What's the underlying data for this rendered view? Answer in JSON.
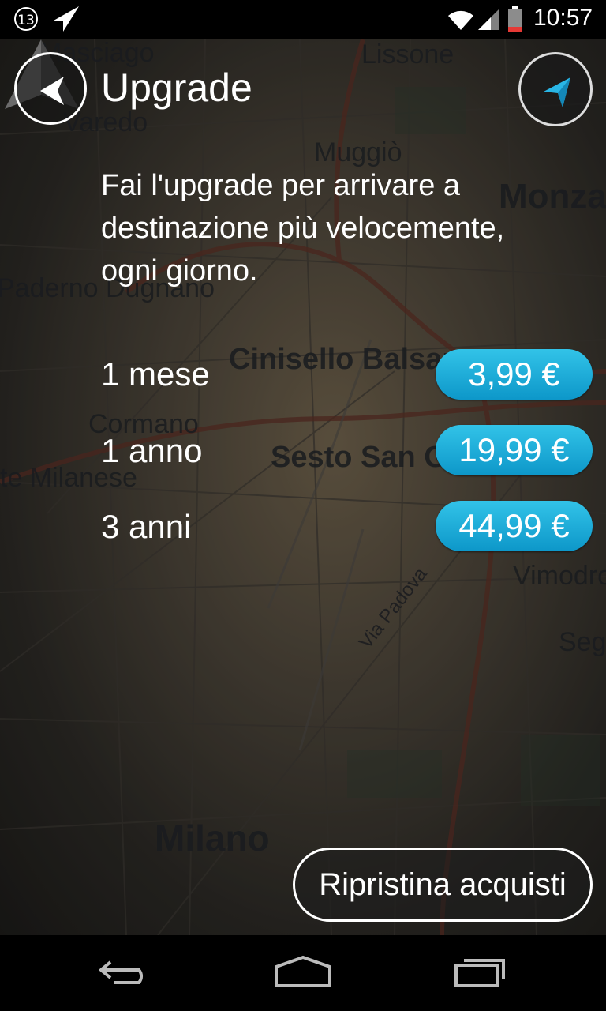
{
  "status_bar": {
    "notification_count": "13",
    "time": "10:57",
    "icons": [
      "notification-count-icon",
      "navigation-arrow-icon",
      "wifi-icon",
      "signal-icon",
      "battery-icon"
    ]
  },
  "map_labels": [
    "Masciago",
    "Lissone",
    "Varedo",
    "Muggiò",
    "Monza",
    "Paderno Dugnano",
    "Cinisello Balsamo",
    "Cormano",
    "Sesto San Giovanni",
    "te Milanese",
    "Vimodrone",
    "Via Padova",
    "Segrate",
    "Milano"
  ],
  "header": {
    "title": "Upgrade",
    "back_icon": "back-arrow-icon",
    "nav_icon": "current-location-arrow-icon"
  },
  "description": "Fai l'upgrade per arrivare a destinazione più velocemente, ogni giorno.",
  "plans": [
    {
      "label": "1 mese",
      "price": "3,99 €"
    },
    {
      "label": "1 anno",
      "price": "19,99 €"
    },
    {
      "label": "3 anni",
      "price": "44,99 €"
    }
  ],
  "restore_button": "Ripristina acquisti",
  "colors": {
    "accent": "#1aaed8",
    "background": "#000000",
    "text": "#ffffff"
  },
  "nav_bar": {
    "icons": [
      "back-icon",
      "home-icon",
      "recents-icon"
    ]
  }
}
